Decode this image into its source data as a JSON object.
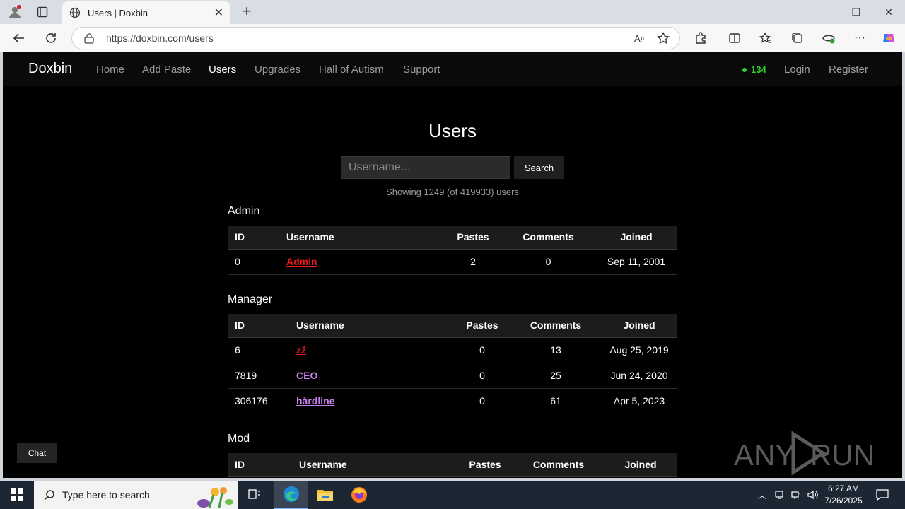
{
  "browser": {
    "tab_title": "Users | Doxbin",
    "url": "https://doxbin.com/users"
  },
  "site": {
    "brand": "Doxbin",
    "nav": [
      {
        "label": "Home"
      },
      {
        "label": "Add Paste"
      },
      {
        "label": "Users",
        "active": true
      },
      {
        "label": "Upgrades"
      },
      {
        "label": "Hall of Autism"
      },
      {
        "label": "Support"
      }
    ],
    "online_count": "134",
    "login": "Login",
    "register": "Register"
  },
  "main": {
    "title": "Users",
    "search_placeholder": "Username...",
    "search_button": "Search",
    "showing": "Showing 1249 (of 419933) users",
    "columns": [
      "ID",
      "Username",
      "Pastes",
      "Comments",
      "Joined"
    ],
    "sections": [
      {
        "title": "Admin",
        "rows": [
          {
            "id": "0",
            "username": "Admin",
            "pastes": "2",
            "comments": "0",
            "joined": "Sep 11, 2001",
            "color": "#e81a1a"
          }
        ]
      },
      {
        "title": "Manager",
        "rows": [
          {
            "id": "6",
            "username": "zž",
            "pastes": "0",
            "comments": "13",
            "joined": "Aug 25, 2019",
            "color": "#e81a1a"
          },
          {
            "id": "7819",
            "username": "CEO",
            "pastes": "0",
            "comments": "25",
            "joined": "Jun 24, 2020",
            "color": "#c680e8"
          },
          {
            "id": "306176",
            "username": "hàrdline",
            "pastes": "0",
            "comments": "61",
            "joined": "Apr 5, 2023",
            "color": "#c680e8"
          }
        ]
      },
      {
        "title": "Mod",
        "rows": []
      }
    ],
    "chat_button": "Chat",
    "watermark": "ANY RUN"
  },
  "taskbar": {
    "search_placeholder": "Type here to search",
    "time": "6:27 AM",
    "date": "7/26/2025"
  }
}
